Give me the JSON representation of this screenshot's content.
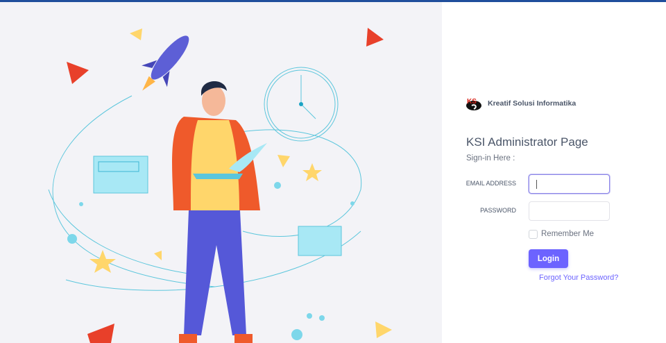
{
  "brand": {
    "name": "Kreatif Solusi Informatika",
    "logo_text": "KSI"
  },
  "page": {
    "title": "KSI Administrator Page",
    "subtitle": "Sign-in Here :"
  },
  "form": {
    "email_label": "EMAIL ADDRESS",
    "email_value": "",
    "password_label": "PASSWORD",
    "password_value": "",
    "remember_label": "Remember Me",
    "remember_checked": false,
    "login_label": "Login",
    "forgot_label": "Forgot Your Password?"
  },
  "colors": {
    "accent": "#6c63ff",
    "topbar": "#1f4e9c",
    "panel": "#f3f3f7"
  }
}
